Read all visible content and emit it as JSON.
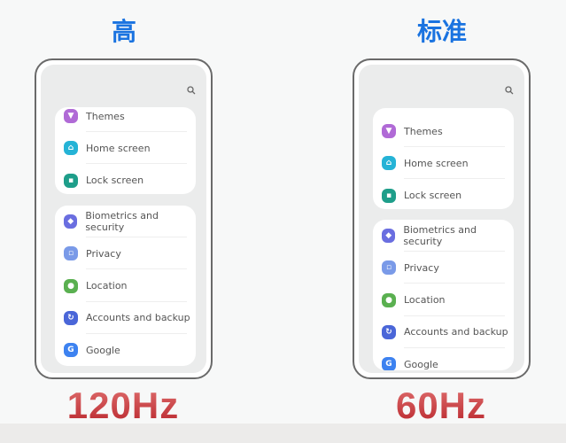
{
  "panels": [
    {
      "heading": "高",
      "rate": "120Hz",
      "card1": [
        {
          "label": "Themes",
          "icon": "themes-icon",
          "color": "#b06ad6"
        },
        {
          "label": "Home screen",
          "icon": "home-icon",
          "color": "#25b3d6"
        },
        {
          "label": "Lock screen",
          "icon": "lock-icon",
          "color": "#1e9e8a"
        }
      ],
      "card2": [
        {
          "label": "Biometrics and security",
          "icon": "shield-icon",
          "color": "#6a6ee0"
        },
        {
          "label": "Privacy",
          "icon": "privacy-icon",
          "color": "#7a9ae8"
        },
        {
          "label": "Location",
          "icon": "location-icon",
          "color": "#5ab050"
        },
        {
          "label": "Accounts and backup",
          "icon": "sync-icon",
          "color": "#4a66d8"
        },
        {
          "label": "Google",
          "icon": "google-icon",
          "color": "#3d82f0"
        }
      ]
    },
    {
      "heading": "标准",
      "rate": "60Hz",
      "card1": [
        {
          "label": "Themes",
          "icon": "themes-icon",
          "color": "#b06ad6"
        },
        {
          "label": "Home screen",
          "icon": "home-icon",
          "color": "#25b3d6"
        },
        {
          "label": "Lock screen",
          "icon": "lock-icon",
          "color": "#1e9e8a"
        }
      ],
      "card2": [
        {
          "label": "Biometrics and security",
          "icon": "shield-icon",
          "color": "#6a6ee0"
        },
        {
          "label": "Privacy",
          "icon": "privacy-icon",
          "color": "#7a9ae8"
        },
        {
          "label": "Location",
          "icon": "location-icon",
          "color": "#5ab050"
        },
        {
          "label": "Accounts and backup",
          "icon": "sync-icon",
          "color": "#4a66d8"
        },
        {
          "label": "Google",
          "icon": "google-icon",
          "color": "#3d82f0"
        }
      ]
    }
  ]
}
